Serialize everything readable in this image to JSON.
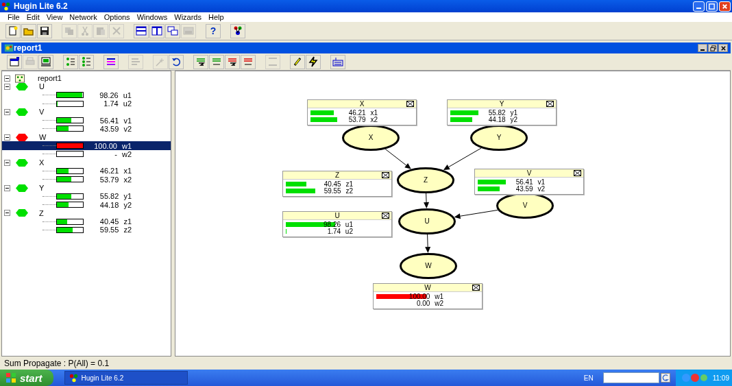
{
  "window": {
    "title": "Hugin Lite 6.2"
  },
  "menu": [
    "File",
    "Edit",
    "View",
    "Network",
    "Options",
    "Windows",
    "Wizards",
    "Help"
  ],
  "main_toolbar": [
    {
      "kind": "new",
      "disabled": false
    },
    {
      "kind": "open",
      "disabled": false
    },
    {
      "kind": "save",
      "disabled": false
    },
    {
      "kind": "copy",
      "disabled": true
    },
    {
      "kind": "cut",
      "disabled": true
    },
    {
      "kind": "paste",
      "disabled": true
    },
    {
      "kind": "delete",
      "disabled": true
    },
    {
      "kind": "tileh",
      "disabled": false
    },
    {
      "kind": "tilev",
      "disabled": false
    },
    {
      "kind": "cascade",
      "disabled": false
    },
    {
      "kind": "arrange",
      "disabled": true
    },
    {
      "kind": "help",
      "text": "?",
      "disabled": false
    },
    {
      "kind": "net",
      "disabled": false
    }
  ],
  "document": {
    "title": "report1"
  },
  "doc_toolbar": [
    {
      "kind": "props",
      "disabled": false
    },
    {
      "kind": "print",
      "disabled": true
    },
    {
      "kind": "monitor",
      "disabled": false
    },
    {
      "kind": "tree1",
      "disabled": false
    },
    {
      "kind": "tree2",
      "disabled": false
    },
    {
      "kind": "bars",
      "disabled": false
    },
    {
      "kind": "align",
      "disabled": true
    },
    {
      "kind": "wand",
      "disabled": true
    },
    {
      "kind": "reset",
      "disabled": false
    },
    {
      "kind": "sumg",
      "disabled": false
    },
    {
      "kind": "maxg",
      "disabled": false
    },
    {
      "kind": "sumr",
      "disabled": false
    },
    {
      "kind": "maxr",
      "disabled": false
    },
    {
      "kind": "arrow",
      "disabled": true
    },
    {
      "kind": "pencil",
      "disabled": false
    },
    {
      "kind": "bolt",
      "disabled": false
    },
    {
      "kind": "keyboard",
      "disabled": false
    }
  ],
  "tree": {
    "root": "report1",
    "expanded": true,
    "nodes": [
      {
        "name": "U",
        "color": "#00e000",
        "expanded": true,
        "states": [
          {
            "reading": "98.26 u1",
            "level": 0.98,
            "selected": false
          },
          {
            "reading": "1.74 u2",
            "level": 0.02,
            "selected": false
          }
        ]
      },
      {
        "name": "V",
        "color": "#00e000",
        "expanded": true,
        "states": [
          {
            "reading": "56.41 v1",
            "level": 0.56,
            "selected": false
          },
          {
            "reading": "43.59 v2",
            "level": 0.44,
            "selected": false
          }
        ]
      },
      {
        "name": "W",
        "color": "#ff0000",
        "expanded": true,
        "states": [
          {
            "reading": "100.00 w1",
            "level": 1,
            "selected": true
          },
          {
            "reading": "- w2",
            "selected": false
          }
        ]
      },
      {
        "name": "X",
        "color": "#00e000",
        "expanded": true,
        "states": [
          {
            "reading": "46.21 x1",
            "level": 0.46,
            "selected": false
          },
          {
            "reading": "53.79 x2",
            "level": 0.54,
            "selected": false
          }
        ]
      },
      {
        "name": "Y",
        "color": "#00e000",
        "expanded": true,
        "states": [
          {
            "reading": "55.82 y1",
            "level": 0.56,
            "selected": false
          },
          {
            "reading": "44.18 y2",
            "level": 0.44,
            "selected": false
          }
        ]
      },
      {
        "name": "Z",
        "color": "#00e000",
        "expanded": true,
        "states": [
          {
            "reading": "40.45 z1",
            "level": 0.4,
            "selected": false
          },
          {
            "reading": "59.55 z2",
            "level": 0.6,
            "selected": false
          }
        ]
      }
    ]
  },
  "graph_nodes": [
    "X",
    "Y",
    "Z",
    "V",
    "U",
    "W"
  ],
  "monitors": [
    {
      "title": "X",
      "color": "#00e000",
      "states": [
        "46.21 x1",
        "53.79 x2"
      ]
    },
    {
      "title": "Y",
      "color": "#00e000",
      "states": [
        "55.82 y1",
        "44.18 y2"
      ]
    },
    {
      "title": "Z",
      "color": "#00e000",
      "states": [
        "40.45 z1",
        "59.55 z2"
      ]
    },
    {
      "title": "V",
      "color": "#00e000",
      "states": [
        "56.41 v1",
        "43.59 v2"
      ]
    },
    {
      "title": "U",
      "color": "#00e000",
      "states": [
        "98.26 u1",
        "1.74 u2"
      ]
    },
    {
      "title": "W",
      "color": "#ff0000",
      "states": [
        "100.00 w1",
        "0.00 w2"
      ]
    }
  ],
  "status_bar": "Sum Propagate : P(All) = 0.1",
  "taskbar": {
    "start": "start",
    "task": "Hugin Lite 6.2",
    "language": "EN",
    "clock": "11:09"
  }
}
